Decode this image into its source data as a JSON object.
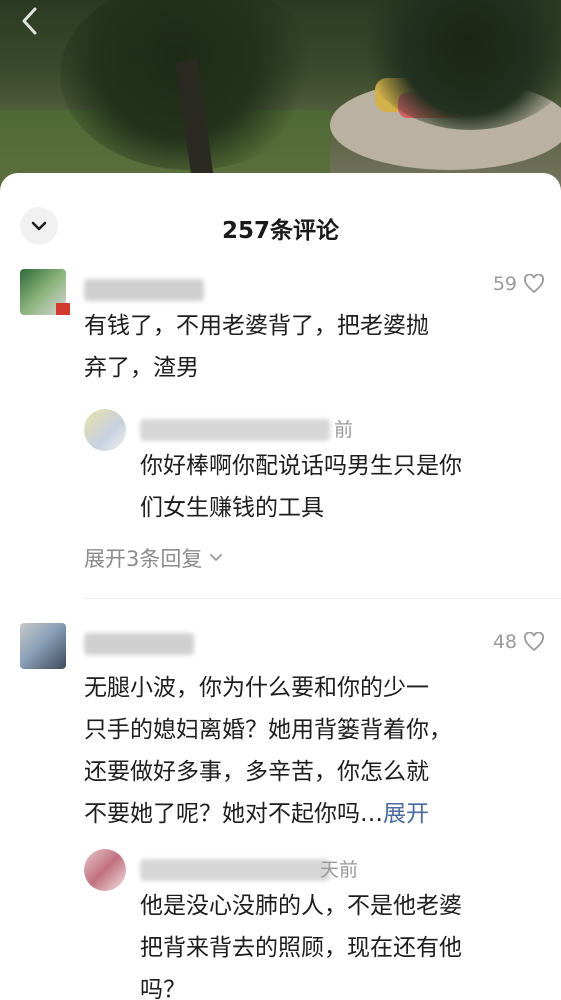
{
  "sheet": {
    "title": "257条评论"
  },
  "comments": [
    {
      "time_tail": "",
      "likes": "59",
      "text_lines": [
        "有钱了，不用老婆背了，把老婆抛",
        "弃了，渣男"
      ],
      "reply": {
        "time_tail": "前",
        "text_lines": [
          "你好棒啊你配说话吗男生只是你",
          "们女生赚钱的工具"
        ]
      },
      "expand_replies": "展开3条回复"
    },
    {
      "time_tail": "",
      "likes": "48",
      "text_lines": [
        "无腿小波，你为什么要和你的少一",
        "只手的媳妇离婚？她用背篓背着你，",
        "还要做好多事，多辛苦，你怎么就",
        "不要她了呢？她对不起你吗…"
      ],
      "expand_inline": "展开",
      "reply": {
        "time_tail": "天前",
        "text_lines": [
          "他是没心没肺的人，不是他老婆",
          "把背来背去的照顾，现在还有他",
          "吗？"
        ]
      }
    }
  ],
  "icons": {
    "back": "chevron-left-icon",
    "collapse": "chevron-down-icon",
    "like": "heart-outline-icon",
    "expand": "chevron-down-small-icon"
  }
}
